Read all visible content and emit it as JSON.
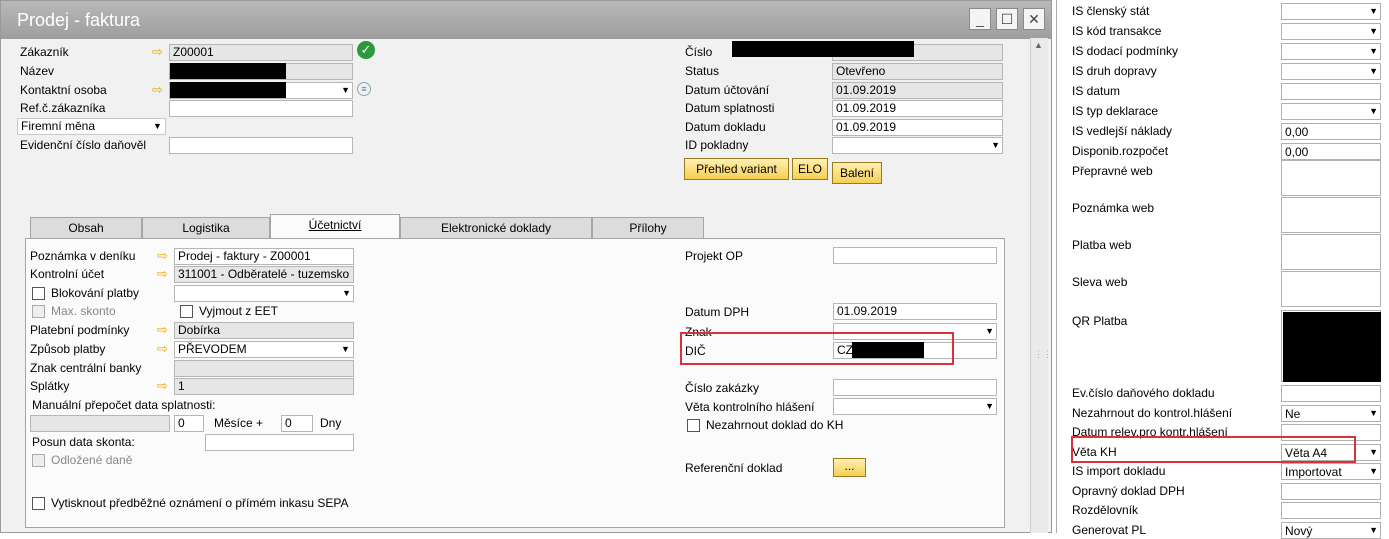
{
  "window": {
    "title": "Prodej - faktura",
    "min": "_",
    "max": "☐",
    "close": "✕"
  },
  "header": {
    "zakaznik_lbl": "Zákazník",
    "zakaznik_val": "Z00001",
    "nazev_lbl": "Název",
    "kontakt_lbl": "Kontaktní osoba",
    "ref_lbl": "Ref.č.zákazníka",
    "mena_val": "Firemní měna",
    "evid_lbl": "Evidenční číslo daňověl",
    "cislo_lbl": "Číslo",
    "status_lbl": "Status",
    "status_val": "Otevřeno",
    "datum_uct_lbl": "Datum účtování",
    "datum_uct_val": "01.09.2019",
    "datum_spl_lbl": "Datum splatnosti",
    "datum_spl_val": "01.09.2019",
    "datum_dok_lbl": "Datum dokladu",
    "datum_dok_val": "01.09.2019",
    "id_pokl_lbl": "ID pokladny",
    "btn_varianty": "Přehled variant",
    "btn_elo": "ELO",
    "btn_baleni": "Balení"
  },
  "tabs": [
    "Obsah",
    "Logistika",
    "Účetnictví",
    "Elektronické doklady",
    "Přílohy"
  ],
  "acc": {
    "poznamka_lbl": "Poznámka v deníku",
    "poznamka_val": "Prodej - faktury - Z00001",
    "kontrolni_lbl": "Kontrolní účet",
    "kontrolni_val": "311001 - Odběratelé - tuzemsko",
    "blokovani_lbl": "Blokování platby",
    "max_skonto_lbl": "Max. skonto",
    "vyjmout_lbl": "Vyjmout z EET",
    "platebni_lbl": "Platební podmínky",
    "platebni_val": "Dobírka",
    "zpusob_lbl": "Způsob platby",
    "zpusob_val": "PŘEVODEM",
    "znak_cb_lbl": "Znak centrální banky",
    "splatky_lbl": "Splátky",
    "splatky_val": "1",
    "manual_lbl": "Manuální přepočet data splatnosti:",
    "mesice_val": "0",
    "mesice_lbl": "Měsíce +",
    "dny_val": "0",
    "dny_lbl": "Dny",
    "posun_lbl": "Posun data skonta:",
    "odlozene_lbl": "Odložené daně",
    "sepa_lbl": "Vytisknout předběžné oznámení o přímém inkasu SEPA",
    "projekt_lbl": "Projekt OP",
    "datum_dph_lbl": "Datum DPH",
    "datum_dph_val": "01.09.2019",
    "znak_lbl": "Znak",
    "dic_lbl": "DIČ",
    "dic_val": "CZ",
    "cislo_zak_lbl": "Číslo zakázky",
    "veta_lbl": "Věta kontrolního hlášení",
    "nezahrnout_lbl": "Nezahrnout doklad do KH",
    "ref_dok_lbl": "Referenční doklad",
    "ref_dok_btn": "..."
  },
  "right": {
    "rows": [
      {
        "label": "IS členský stát",
        "value": "",
        "dd": true
      },
      {
        "label": "IS kód transakce",
        "value": "",
        "dd": true
      },
      {
        "label": "IS dodací podmínky",
        "value": "",
        "dd": true
      },
      {
        "label": "IS druh dopravy",
        "value": "",
        "dd": true
      },
      {
        "label": "IS datum",
        "value": "",
        "dd": false
      },
      {
        "label": "IS typ deklarace",
        "value": "",
        "dd": true
      },
      {
        "label": "IS vedlejší náklady",
        "value": "0,00",
        "dd": false
      },
      {
        "label": "Disponib.rozpočet",
        "value": "0,00",
        "dd": false
      }
    ],
    "prepravne": "Přepravné web",
    "poznamka_web": "Poznámka web",
    "platba_web": "Platba web",
    "sleva_web": "Sleva web",
    "qr": "QR Platba",
    "rows2": [
      {
        "label": "Ev.číslo daňového dokladu",
        "value": "",
        "dd": false
      },
      {
        "label": "Nezahrnout do kontrol.hlášení",
        "value": "Ne",
        "dd": true
      },
      {
        "label": "Datum relev.pro kontr.hlášení",
        "value": "",
        "dd": false
      },
      {
        "label": "Věta KH",
        "value": "Věta A4",
        "dd": true
      },
      {
        "label": "IS import dokladu",
        "value": "Importovat",
        "dd": true
      },
      {
        "label": "Opravný doklad DPH",
        "value": "",
        "dd": false
      },
      {
        "label": "Rozdělovník",
        "value": "",
        "dd": false
      },
      {
        "label": "Generovat PL",
        "value": "Nový",
        "dd": true
      }
    ]
  }
}
